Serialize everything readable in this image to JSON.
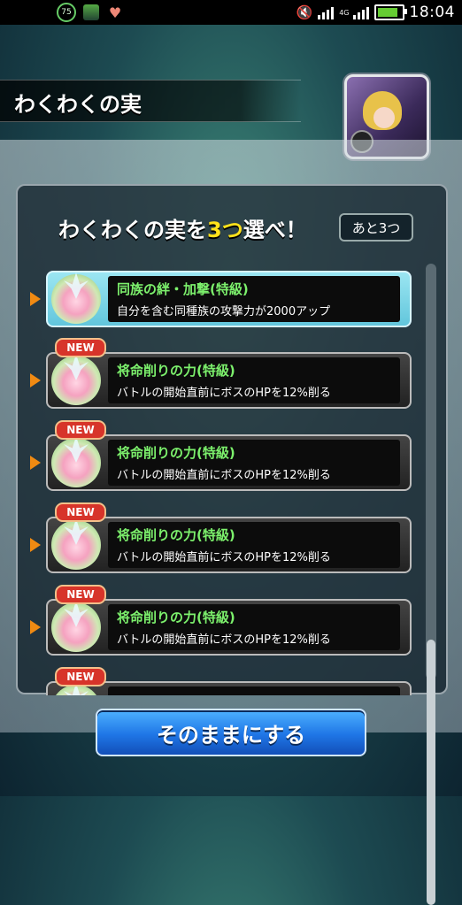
{
  "status_bar": {
    "battery_badge": "75",
    "network_type": "4G",
    "time": "18:04",
    "battery_fill_fraction": 0.85
  },
  "header": {
    "title": "わくわくの実"
  },
  "panel": {
    "heading_prefix": "わくわくの実を",
    "heading_highlight": "3つ",
    "heading_suffix": "選べ！",
    "remaining_badge": "あと3つ"
  },
  "fruit_list": {
    "items": [
      {
        "name": "同族の絆・加撃(特級)",
        "desc": "自分を含む同種族の攻撃力が2000アップ",
        "new": false,
        "selected": true
      },
      {
        "name": "将命削りの力(特級)",
        "desc": "バトルの開始直前にボスのHPを12%削る",
        "new": true,
        "selected": false
      },
      {
        "name": "将命削りの力(特級)",
        "desc": "バトルの開始直前にボスのHPを12%削る",
        "new": true,
        "selected": false
      },
      {
        "name": "将命削りの力(特級)",
        "desc": "バトルの開始直前にボスのHPを12%削る",
        "new": true,
        "selected": false
      },
      {
        "name": "将命削りの力(特級)",
        "desc": "バトルの開始直前にボスのHPを12%削る",
        "new": true,
        "selected": false
      },
      {
        "name": "",
        "desc": "",
        "new": true,
        "selected": false
      }
    ],
    "new_tag": "NEW"
  },
  "buttons": {
    "confirm_label": "そのままにする"
  },
  "colors": {
    "accent_orange": "#f08a12",
    "highlight_yellow": "#ffe21a",
    "name_green": "#7cf06c",
    "button_blue": "#1f76e6"
  }
}
